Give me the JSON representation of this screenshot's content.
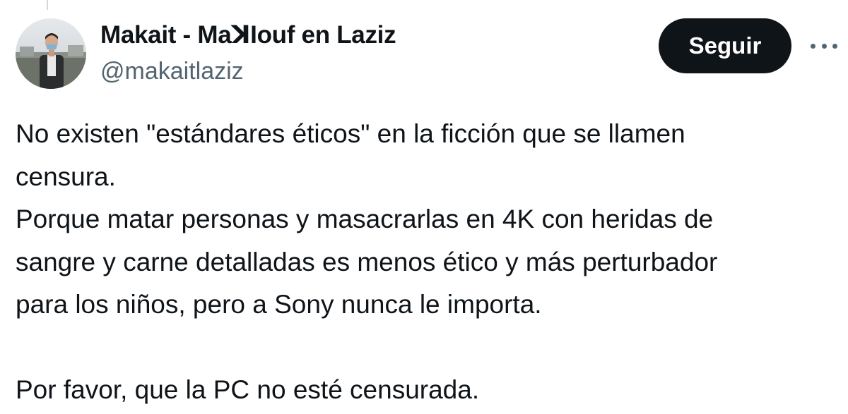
{
  "tweet": {
    "author": {
      "display_name": "Makait - MaꓘIouf en Laziz",
      "handle": "@makaitlaziz"
    },
    "follow_label": "Seguir",
    "more_icon": "more-horizontal-icon",
    "text_lines": [
      "No existen \"estándares éticos\" en la ficción que se llamen",
      "censura.",
      "Porque matar personas y masacrarlas en 4K con heridas de",
      "sangre y carne detalladas es menos ético y más perturbador",
      "para los niños, pero a Sony nunca le importa.",
      "",
      "Por favor, que la PC no esté censurada."
    ]
  },
  "colors": {
    "text": "#0f1419",
    "secondary_text": "#536471",
    "button_bg": "#0f1419",
    "button_text": "#ffffff",
    "background": "#ffffff"
  }
}
